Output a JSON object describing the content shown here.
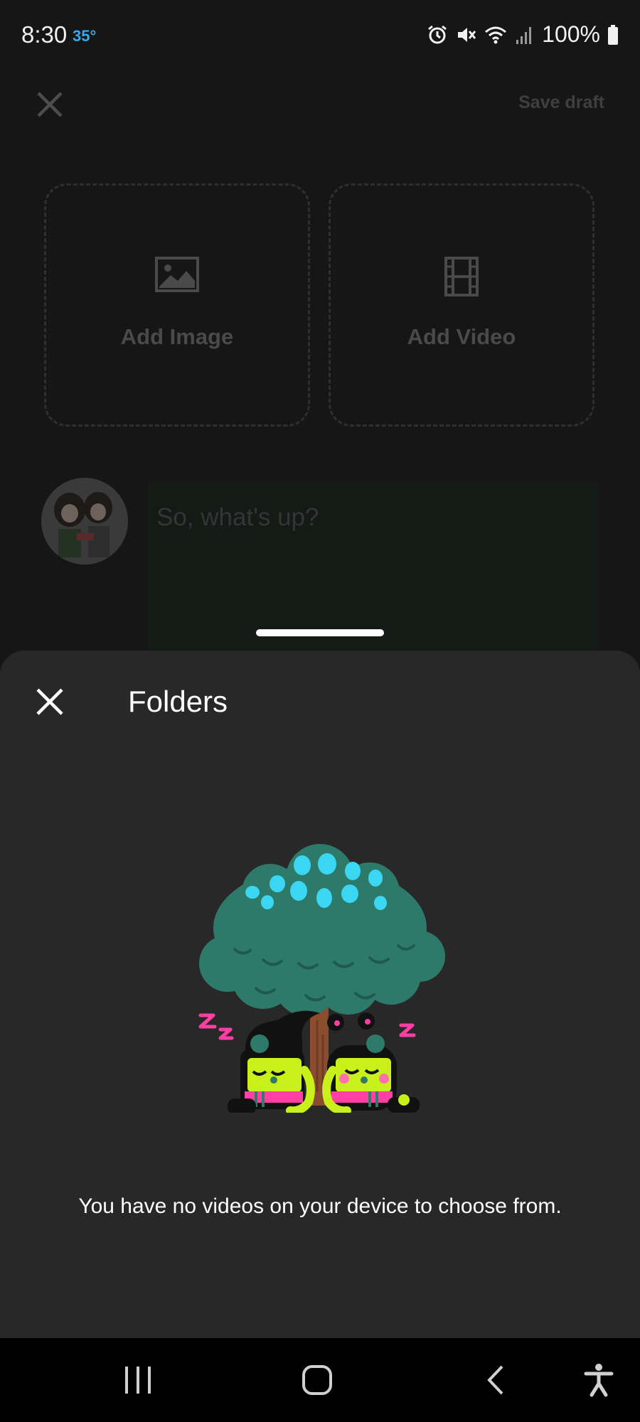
{
  "status_bar": {
    "time": "8:30",
    "temperature": "35°",
    "battery": "100%",
    "icons": [
      "alarm-icon",
      "mute-icon",
      "wifi-icon",
      "signal-icon",
      "battery-icon"
    ]
  },
  "composer": {
    "save_draft_label": "Save draft",
    "add_image_label": "Add Image",
    "add_video_label": "Add Video",
    "post_placeholder": "So, what's up?"
  },
  "folders_sheet": {
    "title": "Folders",
    "empty_message": "You have no videos on your device to choose from."
  },
  "colors": {
    "accent_temp": "#39a9e8",
    "sheet_background": "#282828",
    "page_background": "#161616"
  },
  "navigation": {
    "icons": [
      "recent-apps-icon",
      "home-icon",
      "back-icon",
      "accessibility-icon"
    ]
  }
}
